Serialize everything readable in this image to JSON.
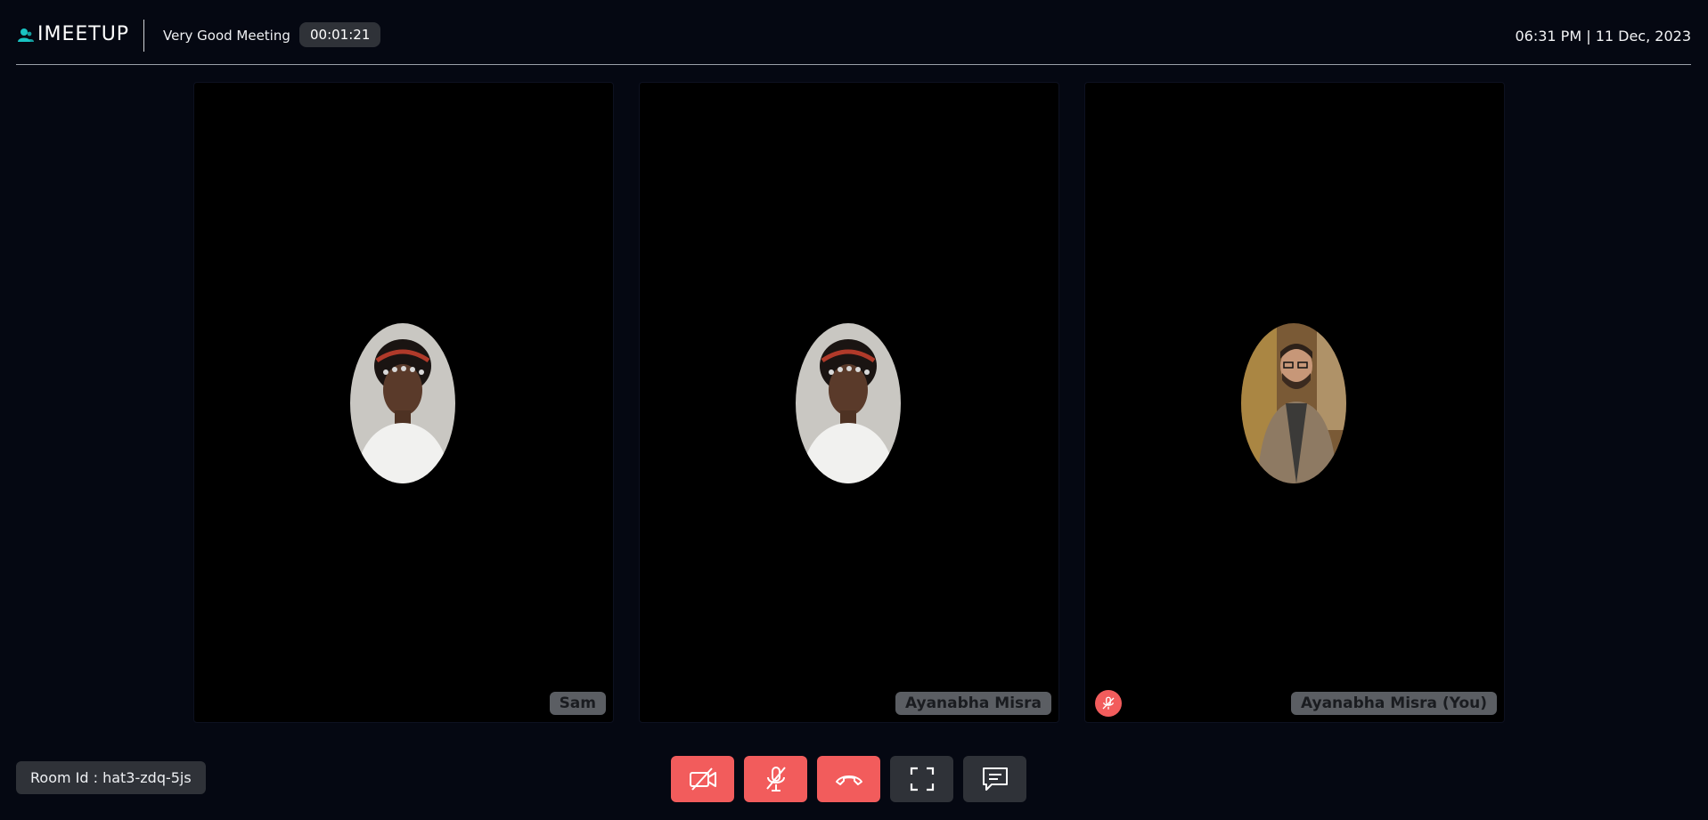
{
  "app": {
    "name": "IMEETUP"
  },
  "header": {
    "meeting_title": "Very Good Meeting",
    "timer": "00:01:21",
    "datetime": "06:31 PM | 11 Dec, 2023"
  },
  "participants": [
    {
      "name": "Sam",
      "avatar": "participant-photo-woman",
      "muted_indicator": false
    },
    {
      "name": "Ayanabha Misra",
      "avatar": "participant-photo-woman",
      "muted_indicator": false
    },
    {
      "name": "Ayanabha Misra (You)",
      "avatar": "participant-photo-man",
      "muted_indicator": true
    }
  ],
  "room": {
    "label": "Room Id : hat3-zdq-5js"
  },
  "controls": [
    {
      "icon": "video-off-icon",
      "state": "off"
    },
    {
      "icon": "mic-off-icon",
      "state": "off"
    },
    {
      "icon": "hang-up-icon",
      "state": "end-call"
    },
    {
      "icon": "fullscreen-icon",
      "state": "normal"
    },
    {
      "icon": "chat-icon",
      "state": "normal"
    }
  ],
  "colors": {
    "background": "#050812",
    "accent_red": "#f25c5c",
    "control_dark": "#2f3238",
    "logo_teal": "#19c3c3",
    "name_tag": "#5b5e63"
  }
}
